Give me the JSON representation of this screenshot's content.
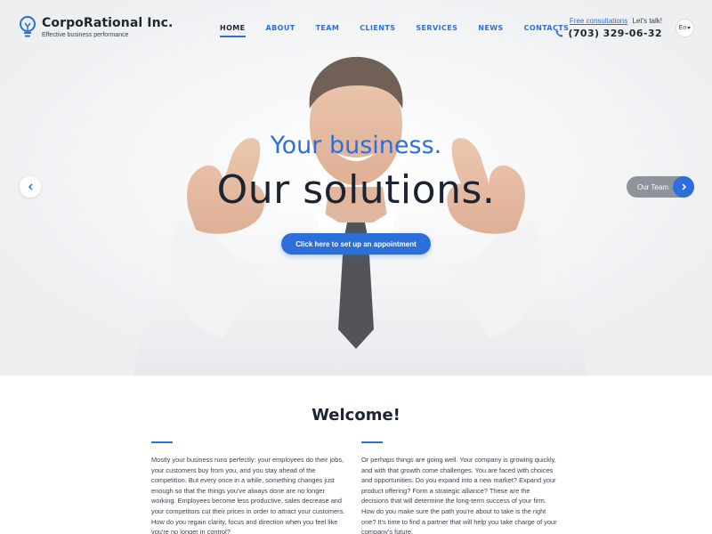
{
  "header": {
    "brand": "CorpoRational Inc.",
    "tagline": "Effective business performance",
    "nav": [
      {
        "label": "HOME",
        "active": true
      },
      {
        "label": "ABOUT",
        "active": false
      },
      {
        "label": "TEAM",
        "active": false
      },
      {
        "label": "CLIENTS",
        "active": false
      },
      {
        "label": "SERVICES",
        "active": false
      },
      {
        "label": "NEWS",
        "active": false
      },
      {
        "label": "CONTACTS",
        "active": false
      }
    ],
    "contact_link": "Free consultations",
    "contact_text": "Let's talk!",
    "phone": "(703) 329-06-32",
    "language": "En"
  },
  "hero": {
    "subtitle": "Your business.",
    "title": "Our solutions.",
    "cta_label": "Click here to set up an appointment",
    "next_slide_label": "Our Team",
    "prev_icon": "chevron-left-icon",
    "next_icon": "chevron-right-icon"
  },
  "welcome": {
    "title": "Welcome!",
    "left_text": "Mostly your business runs perfectly: your employees do their jobs, your customers buy from you, and you stay ahead of the competition. But every once in a while, something changes just enough so that the things you've always done are no longer working. Employees become less productive, sales decrease and your competitors cut their prices in order to attract your customers. How do you regain clarity, focus and direction when you feel like you're no longer in control?",
    "right_text": "Or perhaps things are going well. Your company is growing quickly, and with that growth come challenges. You are faced with choices and opportunities. Do you expand into a new market? Expand your product offering? Form a strategic alliance? These are the decisions that will determine the long-term success of your firm. How do you make sure the path you're about to take is the right one? It's time to find a partner that will help you take charge of your company's future."
  },
  "colors": {
    "accent": "#2d6fd8",
    "dark": "#1c2331",
    "text": "#3a4150"
  },
  "icons": {
    "logo": "lightbulb-icon",
    "phone": "phone-icon"
  }
}
